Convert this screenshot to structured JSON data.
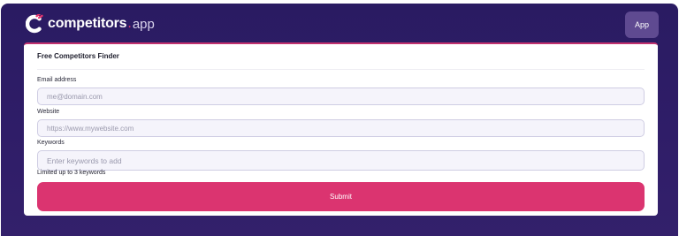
{
  "header": {
    "logo": {
      "icon": "competitors-logo-icon",
      "name": "competitors",
      "dot": ".",
      "tld": "app"
    },
    "app_button_label": "App"
  },
  "form": {
    "title": "Free Competitors Finder",
    "email": {
      "label": "Email address",
      "value": "",
      "placeholder": "me@domain.com"
    },
    "website": {
      "label": "Website",
      "value": "",
      "placeholder": "https://www.mywebsite.com"
    },
    "keywords": {
      "label": "Keywords",
      "value": "",
      "placeholder": "Enter keywords to add",
      "hint": "Limited up to 3 keywords"
    },
    "submit_label": "Submit"
  },
  "colors": {
    "background": "#2d1c66",
    "accent": "#db3470",
    "card": "#ffffff",
    "app_button": "#5f4a91"
  }
}
